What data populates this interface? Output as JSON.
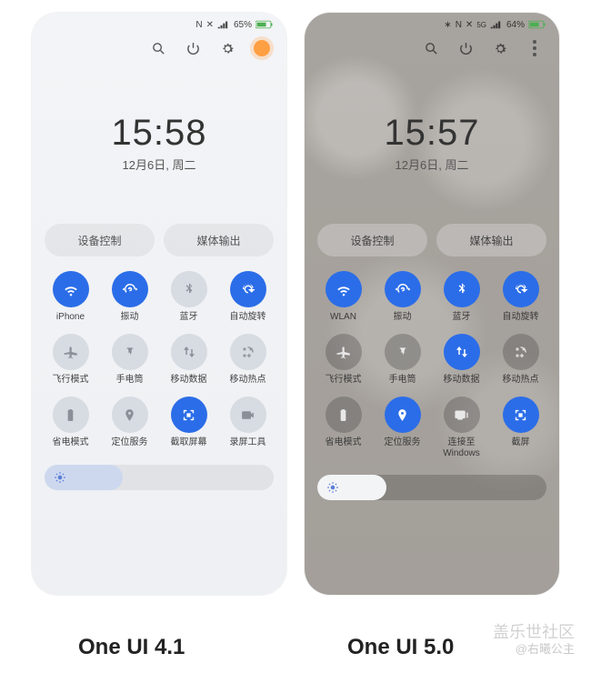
{
  "captions": {
    "left": "One UI 4.1",
    "right": "One UI 5.0"
  },
  "watermark": {
    "line1": "盖乐世社区",
    "line2": "@右曦公主"
  },
  "left": {
    "status": {
      "nfc": "N",
      "battery_pct": "65%"
    },
    "clock": {
      "time": "15:58",
      "date": "12月6日, 周二"
    },
    "pills": [
      "设备控制",
      "媒体输出"
    ],
    "tiles": [
      {
        "icon": "wifi",
        "label": "iPhone",
        "state": "on"
      },
      {
        "icon": "vibrate",
        "label": "振动",
        "state": "on"
      },
      {
        "icon": "bluetooth",
        "label": "蓝牙",
        "state": "off"
      },
      {
        "icon": "rotate",
        "label": "自动旋转",
        "state": "on"
      },
      {
        "icon": "airplane",
        "label": "飞行模式",
        "state": "off"
      },
      {
        "icon": "flash",
        "label": "手电筒",
        "state": "off"
      },
      {
        "icon": "data",
        "label": "移动数据",
        "state": "off"
      },
      {
        "icon": "hotspot",
        "label": "移动热点",
        "state": "off"
      },
      {
        "icon": "battery",
        "label": "省电模式",
        "state": "off"
      },
      {
        "icon": "location",
        "label": "定位服务",
        "state": "off"
      },
      {
        "icon": "capture",
        "label": "截取屏幕",
        "state": "on"
      },
      {
        "icon": "record",
        "label": "录屏工具",
        "state": "off"
      }
    ],
    "brightness_pct": 34
  },
  "right": {
    "status": {
      "bt": "⁂",
      "nfc": "N",
      "net": "5G",
      "battery_pct": "64%"
    },
    "clock": {
      "time": "15:57",
      "date": "12月6日, 周二"
    },
    "pills": [
      "设备控制",
      "媒体输出"
    ],
    "tiles": [
      {
        "icon": "wifi",
        "label": "WLAN",
        "state": "on"
      },
      {
        "icon": "vibrate",
        "label": "振动",
        "state": "on"
      },
      {
        "icon": "bluetooth",
        "label": "蓝牙",
        "state": "on"
      },
      {
        "icon": "rotate",
        "label": "自动旋转",
        "state": "on"
      },
      {
        "icon": "airplane",
        "label": "飞行模式",
        "state": "off"
      },
      {
        "icon": "flash",
        "label": "手电筒",
        "state": "off"
      },
      {
        "icon": "data",
        "label": "移动数据",
        "state": "on"
      },
      {
        "icon": "hotspot",
        "label": "移动热点",
        "state": "off"
      },
      {
        "icon": "battery",
        "label": "省电模式",
        "state": "off"
      },
      {
        "icon": "location",
        "label": "定位服务",
        "state": "on"
      },
      {
        "icon": "link",
        "label": "连接至\nWindows",
        "state": "off"
      },
      {
        "icon": "capture",
        "label": "截屏",
        "state": "on"
      }
    ],
    "brightness_pct": 30
  },
  "icons": {
    "wifi": "<svg viewBox='0 0 24 24' width='18' height='18' fill='currentColor'><path d='M12 18.5a1.7 1.7 0 110 3.4 1.7 1.7 0 010-3.4zm0-5c2 0 3.8.8 5.2 2l-1.8 1.8A5 5 0 0012 16a5 5 0 00-3.4 1.3L6.8 15.5A7.8 7.8 0 0112 13.5zm0-5c3.5 0 6.6 1.3 9 3.5l-1.8 1.8A10.5 10.5 0 0012 11a10.5 10.5 0 00-7.2 2.8L3 12a12.9 12.9 0 019-3.5z'/></svg>",
    "vibrate": "<svg viewBox='0 0 24 24' width='18' height='18' fill='currentColor'><path d='M3 14l-2-2 2-2 2 2-2 2zm18 0l-2-2 2-2 2 2-2 2zM12 4a8 8 0 00-6 13.2l1.4-1.4A6 6 0 1118 12h2a8 8 0 00-8-8zm0 5a3 3 0 00-3 3h2a1 1 0 112 0c0 .6-.4 1-1 1h-1v2h1a3 3 0 000-6z'/></svg>",
    "bluetooth": "<svg viewBox='0 0 24 24' width='16' height='16' fill='currentColor'><path d='M12 2l5 5-3.5 3.5L17 14l-5 5v-6.6L8.5 16 7 14.5 11 10.5 7 6.5 8.5 5 12 8.6V2zm1.5 3.6v3.8L15.4 7l-1.9-1.4zm0 9v3.8L15.4 17l-1.9-1.4z'/></svg>",
    "rotate": "<svg viewBox='0 0 24 24' width='18' height='18' fill='currentColor'><path d='M12 4a8 8 0 017.7 6h-2.1A6 6 0 106 12H4a8 8 0 018-8zm6 8h4l-5 5-5-5h4a4 4 0 10-4 4v2a6 6 0 116-6z'/></svg>",
    "airplane": "<svg viewBox='0 0 24 24' width='18' height='18' fill='currentColor'><path d='M21 14l-8-2V6a1.5 1.5 0 00-3 0v6l-8 2v2l8-1v4l-2 1v1l3.5-.5L15 22v-1l-2-1v-4l8 1z'/></svg>",
    "flash": "<svg viewBox='0 0 24 24' width='16' height='16' fill='currentColor'><path d='M9 7h6v2l-1 3h1l-3 5v-4H9l1-4H9z M8 5h8a1 1 0 011 1v1H7V6a1 1 0 011-1z'/></svg>",
    "data": "<svg viewBox='0 0 24 24' width='18' height='18' fill='currentColor'><path d='M8 4l4 5H9v7H7V9H4l4-5zm8 16l-4-5h3V8h2v7h3l-4 5z'/></svg>",
    "hotspot": "<svg viewBox='0 0 24 24' width='17' height='17' fill='currentColor'><path d='M5 5h4v4H5zm10 0h4v4h-4zM5 15h4v4H5zm12 1h-2v-2h-2v2h-2v2h2v2h2v-2h2zM7 7v0zM12 3a9 9 0 019 9h-2a7 7 0 00-7-7V3z' opacity='.9'/></svg>",
    "battery": "<svg viewBox='0 0 24 24' width='17' height='17' fill='currentColor'><path d='M15 4h-1V3h-4v1H9a1 1 0 00-1 1v15a1 1 0 001 1h6a1 1 0 001-1V5a1 1 0 00-1-1zm-3 3l-2 5h2v4l2-5h-2z'/></svg>",
    "location": "<svg viewBox='0 0 24 24' width='17' height='17' fill='currentColor'><path d='M12 3a6 6 0 016 6c0 4-6 12-6 12S6 13 6 9a6 6 0 016-6zm0 4a2 2 0 100 4 2 2 0 000-4z'/></svg>",
    "capture": "<svg viewBox='0 0 24 24' width='17' height='17' fill='currentColor'><path d='M4 4h5v2H6v3H4zm11 0h5v5h-2V6h-3zM4 15h2v3h3v2H4zm14 0h2v5h-5v-2h3zM9 9h6v6H9z'/></svg>",
    "record": "<svg viewBox='0 0 24 24' width='17' height='17' fill='currentColor'><path d='M5 6h10a2 2 0 012 2v2l4-2v8l-4-2v2a2 2 0 01-2 2H5a2 2 0 01-2-2V8a2 2 0 012-2z'/></svg>",
    "link": "<svg viewBox='0 0 24 24' width='17' height='17' fill='currentColor'><path d='M4 5h12a2 2 0 012 2v8a2 2 0 01-2 2H4a2 2 0 01-2-2V7a2 2 0 012-2zm2 12h8v2H6zM20 8h2v8h-2z'/></svg>",
    "search": "<svg viewBox='0 0 24 24' width='17' height='17' fill='none' stroke='currentColor' stroke-width='2'><circle cx='10' cy='10' r='6'/><path d='M20 20l-5-5'/></svg>",
    "power": "<svg viewBox='0 0 24 24' width='17' height='17' fill='none' stroke='currentColor' stroke-width='2'><path d='M12 3v8'/><path d='M6 7a8 8 0 1012 0'/></svg>",
    "gear": "<svg viewBox='0 0 24 24' width='17' height='17' fill='currentColor'><path d='M12 8a4 4 0 100 8 4 4 0 000-8zm9 4l-2 .4a7 7 0 01-.6 1.5l1.1 1.7-1.5 1.5-1.7-1.1a7 7 0 01-1.5.6L14 19l-2 .3-.4-2a7 7 0 01-1.5-.6l-1.7 1.1-1.5-1.5 1.1-1.7a7 7 0 01-.6-1.5L5 13l-.3-2 2-.4a7 7 0 01.6-1.5L6.2 7.4l1.5-1.5 1.7 1.1a7 7 0 011.5-.6L11 4.3l2-.3.4 2a7 7 0 011.5.6l1.7-1.1 1.5 1.5-1.1 1.7c.3.5.5 1 .6 1.5l2 .4z'/></svg>",
    "sun": "<svg viewBox='0 0 24 24' width='14' height='14' fill='currentColor'><circle cx='12' cy='12' r='4'/><g stroke='currentColor' stroke-width='2'><path d='M12 2v3M12 19v3M2 12h3M19 12h3M5 5l2 2M17 17l2 2M19 5l-2 2M7 17l-2 2'/></g></svg>",
    "signal": "<svg viewBox='0 0 20 12' width='14' height='10' fill='currentColor'><path d='M1 10h3v2H1zm4-3h3v5H5zm4-3h3v8H9zm4-3h3v11h-3z'/></svg>",
    "batt": "<svg viewBox='0 0 26 12' width='20' height='10'><rect x='0' y='1' width='22' height='10' rx='2' fill='none' stroke='currentColor'/><rect x='22' y='4' width='2' height='4' fill='currentColor'/><rect x='2' y='3' width='13' height='6' fill='currentColor'/></svg>"
  }
}
